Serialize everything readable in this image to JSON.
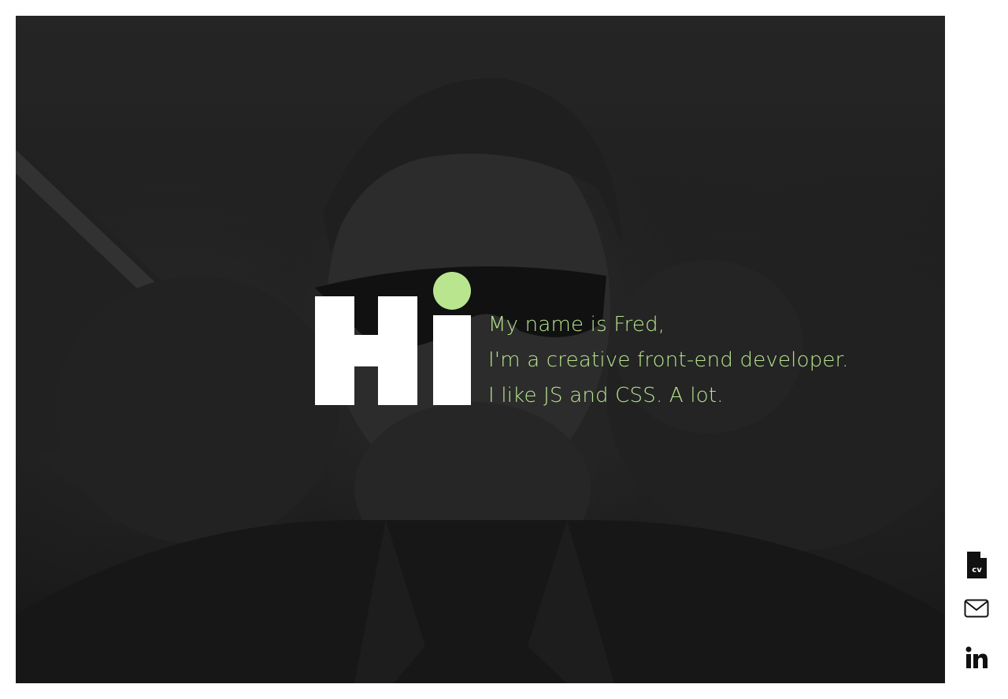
{
  "hero": {
    "logo_text": "Hi",
    "accent_color": "#b9e58f",
    "intro_lines": [
      "My name is Fred,",
      "I'm a creative front-end developer.",
      "I like JS and CSS. A lot."
    ]
  },
  "social": {
    "cv_label": "cv",
    "items": [
      {
        "icon": "cv-document-icon"
      },
      {
        "icon": "mail-icon"
      },
      {
        "icon": "linkedin-icon"
      }
    ]
  }
}
